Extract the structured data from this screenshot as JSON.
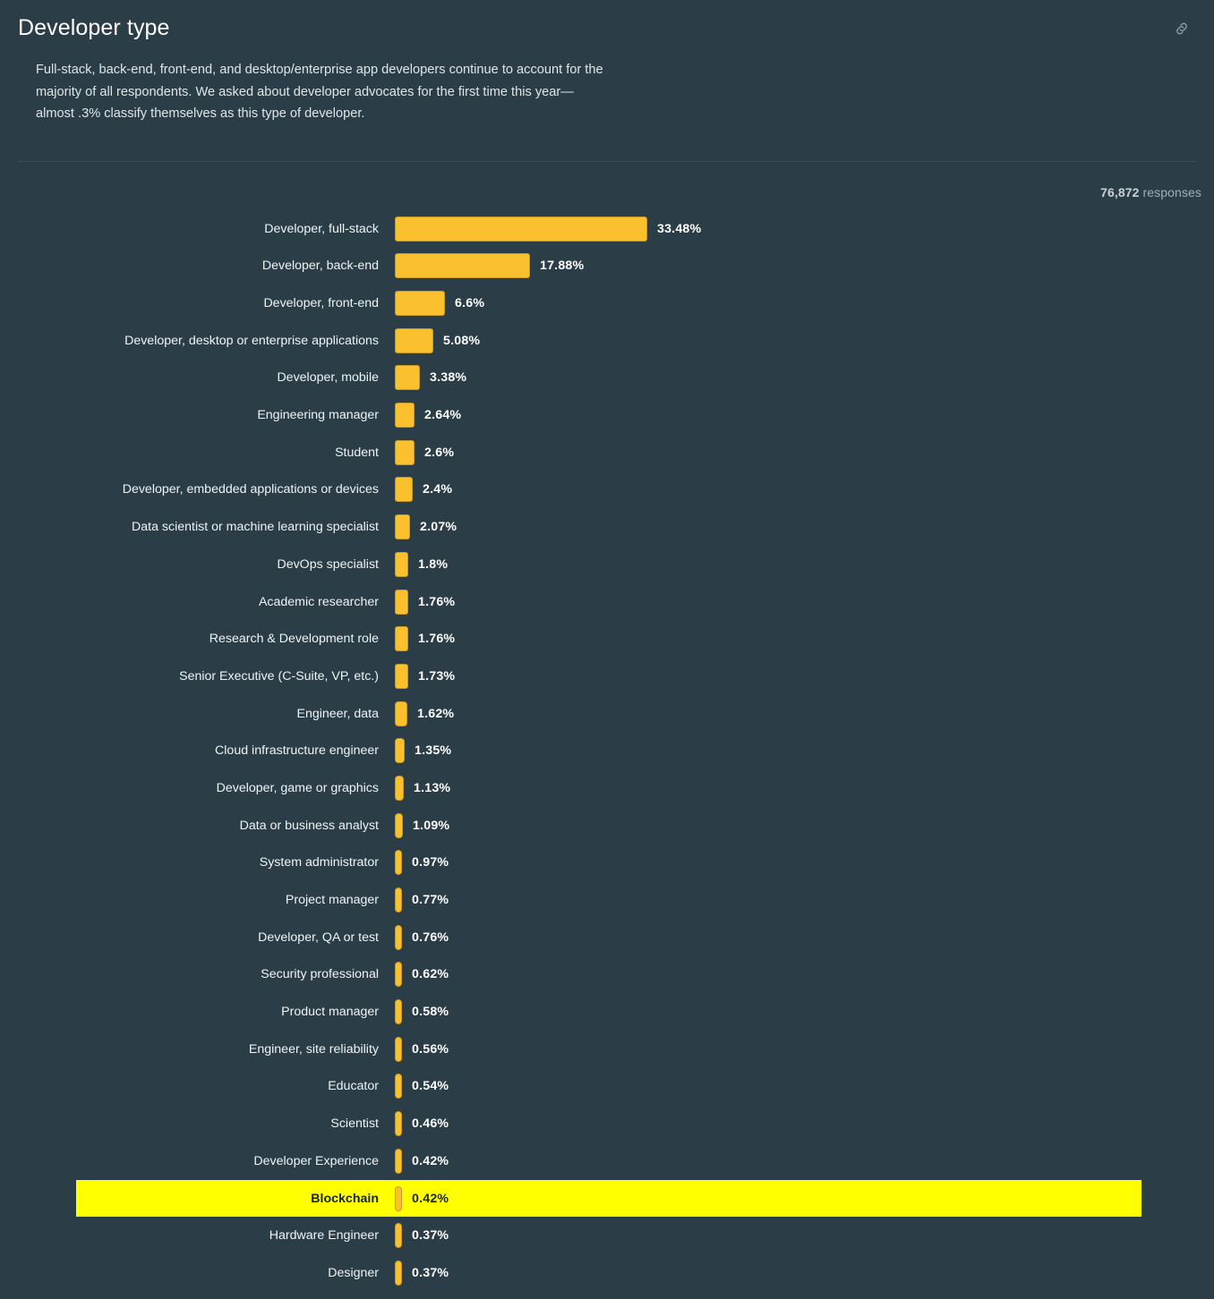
{
  "header": {
    "title": "Developer type",
    "link_icon": "link-chain-icon",
    "description": "Full-stack, back-end, front-end, and desktop/enterprise app developers continue to account for the majority of all respondents. We asked about developer advocates for the first time this year—almost .3% classify themselves as this type of developer."
  },
  "meta": {
    "responses_count": "76,872",
    "responses_label": "responses"
  },
  "colors": {
    "background": "#2b3e47",
    "bar_fill": "#fbc02d",
    "bar_border": "#c79a28",
    "highlight": "#ffff00",
    "text": "#eef3f5",
    "muted_text": "#9fb0b8",
    "divider": "#3c5059"
  },
  "chart_data": {
    "type": "bar",
    "orientation": "horizontal",
    "title": "Developer type",
    "xlabel": "",
    "ylabel": "",
    "grid": false,
    "legend": false,
    "xlim": [
      0,
      33.48
    ],
    "value_suffix": "%",
    "highlighted_category": "Blockchain",
    "categories": [
      "Developer, full-stack",
      "Developer, back-end",
      "Developer, front-end",
      "Developer, desktop or enterprise applications",
      "Developer, mobile",
      "Engineering manager",
      "Student",
      "Developer, embedded applications or devices",
      "Data scientist or machine learning specialist",
      "DevOps specialist",
      "Academic researcher",
      "Research & Development role",
      "Senior Executive (C-Suite, VP, etc.)",
      "Engineer, data",
      "Cloud infrastructure engineer",
      "Developer, game or graphics",
      "Data or business analyst",
      "System administrator",
      "Project manager",
      "Developer, QA or test",
      "Security professional",
      "Product manager",
      "Engineer, site reliability",
      "Educator",
      "Scientist",
      "Developer Experience",
      "Blockchain",
      "Hardware Engineer",
      "Designer"
    ],
    "values": [
      33.48,
      17.88,
      6.6,
      5.08,
      3.38,
      2.64,
      2.6,
      2.4,
      2.07,
      1.8,
      1.76,
      1.76,
      1.73,
      1.62,
      1.35,
      1.13,
      1.09,
      0.97,
      0.77,
      0.76,
      0.62,
      0.58,
      0.56,
      0.54,
      0.46,
      0.42,
      0.42,
      0.37,
      0.37
    ],
    "value_labels": [
      "33.48%",
      "17.88%",
      "6.6%",
      "5.08%",
      "3.38%",
      "2.64%",
      "2.6%",
      "2.4%",
      "2.07%",
      "1.8%",
      "1.76%",
      "1.76%",
      "1.73%",
      "1.62%",
      "1.35%",
      "1.13%",
      "1.09%",
      "0.97%",
      "0.77%",
      "0.76%",
      "0.62%",
      "0.58%",
      "0.56%",
      "0.54%",
      "0.46%",
      "0.42%",
      "0.42%",
      "0.37%",
      "0.37%"
    ]
  }
}
